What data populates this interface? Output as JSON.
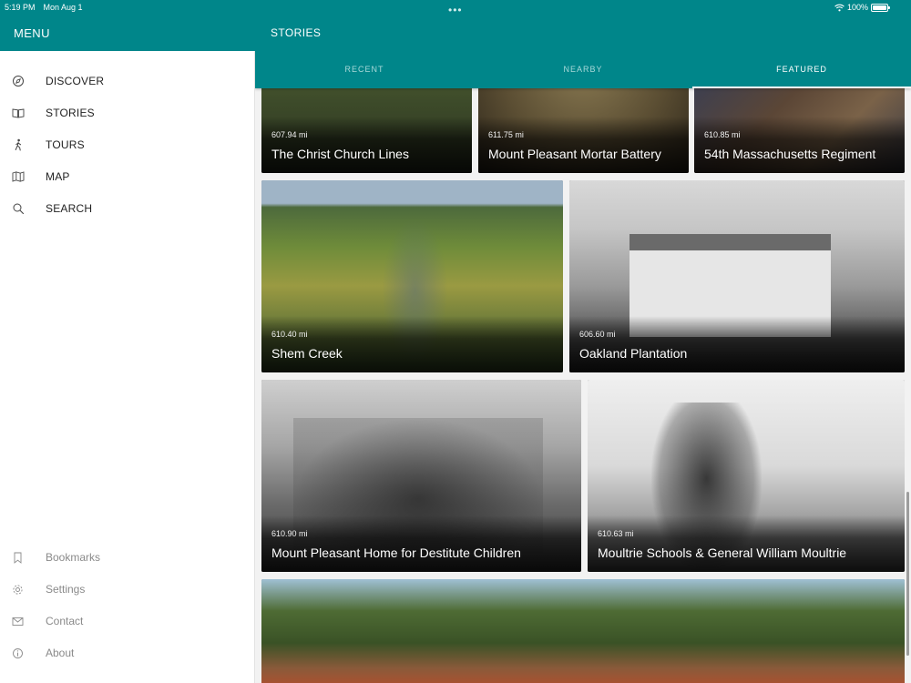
{
  "status": {
    "time": "5:19 PM",
    "date": "Mon Aug 1",
    "battery": "100%",
    "battery_level_percent": 100
  },
  "menu": {
    "title": "MENU",
    "items": [
      {
        "label": "DISCOVER",
        "icon": "compass-icon"
      },
      {
        "label": "STORIES",
        "icon": "book-icon"
      },
      {
        "label": "TOURS",
        "icon": "walking-person-icon"
      },
      {
        "label": "MAP",
        "icon": "map-icon"
      },
      {
        "label": "SEARCH",
        "icon": "search-icon"
      }
    ],
    "secondary": [
      {
        "label": "Bookmarks",
        "icon": "bookmark-icon"
      },
      {
        "label": "Settings",
        "icon": "gear-icon"
      },
      {
        "label": "Contact",
        "icon": "mail-icon"
      },
      {
        "label": "About",
        "icon": "info-icon"
      }
    ]
  },
  "header": {
    "title": "STORIES",
    "dots": "•••"
  },
  "tabs": [
    {
      "label": "RECENT",
      "active": false
    },
    {
      "label": "NEARBY",
      "active": false
    },
    {
      "label": "FEATURED",
      "active": true
    }
  ],
  "stories": [
    {
      "distance": "607.94 mi",
      "title": "The Christ Church Lines"
    },
    {
      "distance": "611.75 mi",
      "title": "Mount Pleasant Mortar Battery"
    },
    {
      "distance": "610.85 mi",
      "title": "54th Massachusetts Regiment"
    },
    {
      "distance": "610.40 mi",
      "title": "Shem Creek"
    },
    {
      "distance": "606.60 mi",
      "title": "Oakland Plantation"
    },
    {
      "distance": "610.90 mi",
      "title": "Mount Pleasant Home for Destitute Children"
    },
    {
      "distance": "610.63 mi",
      "title": "Moultrie Schools & General William Moultrie"
    }
  ],
  "colors": {
    "accent": "#00868a",
    "accent_tab_inactive": "#a9d9d9"
  }
}
